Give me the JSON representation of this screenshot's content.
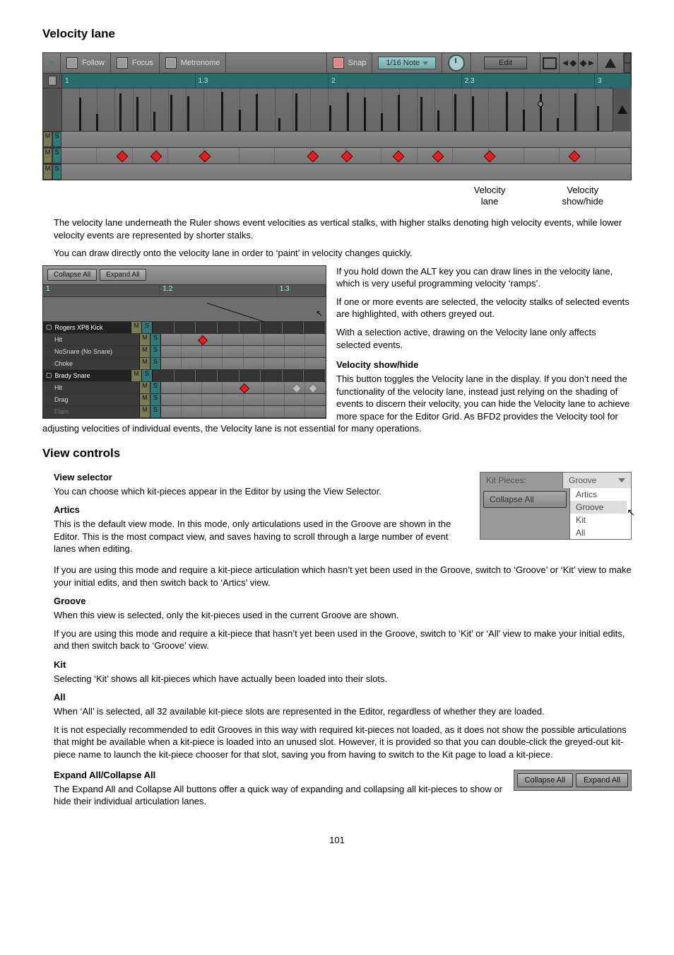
{
  "headings": {
    "velocity_lane": "Velocity lane",
    "velocity_show_hide": "Velocity show/hide",
    "view_controls": "View controls",
    "view_selector": "View selector",
    "artics": "Artics",
    "groove": "Groove",
    "kit": "Kit",
    "all": "All",
    "expand_collapse": "Expand All/Collapse All"
  },
  "toolbar": {
    "follow": "Follow",
    "focus": "Focus",
    "metronome": "Metronome",
    "snap": "Snap",
    "snap_value": "1/16 Note",
    "edit": "Edit"
  },
  "ruler": {
    "m1": "1",
    "m1_3": "1.3",
    "m2": "2",
    "m2_3": "2.3",
    "m3": "3"
  },
  "annot": {
    "velocity_lane_l1": "Velocity",
    "velocity_lane_l2": "lane",
    "show_hide_l1": "Velocity",
    "show_hide_l2": "show/hide"
  },
  "para": {
    "vl_1": "The velocity lane underneath the Ruler shows event velocities as vertical stalks, with higher stalks denoting high velocity events, while lower velocity events are represented by shorter stalks.",
    "vl_2": "You can draw directly onto the velocity lane in order to ‘paint’ in velocity changes quickly.",
    "vl_3": "If you hold down the ALT key you can draw lines in the velocity lane, which is very useful programming velocity ‘ramps’.",
    "vl_4": "If one or more events are selected, the velocity stalks of selected events are highlighted, with others greyed out.",
    "vl_5": "With a selection active, drawing on the Velocity lane only affects selected events.",
    "vsh_1": "This button toggles the Velocity lane in the display. If you don’t need the functionality of the velocity lane, instead just relying on the shading of events to discern their velocity, you can hide the Velocity lane to achieve more space for the Editor Grid. As BFD2 provides the Velocity tool for adjusting velocities of individual events, the Velocity lane is not essential for many operations.",
    "vs_1": "You can choose which kit-pieces appear in the Editor by using the View Selector.",
    "art_1": "This is the default view mode. In this mode, only articulations used in the Groove are shown in the Editor. This is the most compact view, and saves having to scroll through a large number of event lanes when editing.",
    "art_2": "If you are using this mode and require a kit-piece articulation which hasn’t yet been used in the Groove, switch to ‘Groove’ or ‘Kit’ view to make your initial edits, and then switch back to ‘Artics’ view.",
    "gr_1": "When this view is selected, only the kit-pieces used in the current Groove are shown.",
    "gr_2": "If you are using this mode and require a kit-piece that hasn’t yet been used in the Groove, switch to ‘Kit’ or ‘All’ view to make your initial edits, and then switch back to ‘Groove’ view.",
    "kit_1": "Selecting ‘Kit’ shows all kit-pieces which have actually been loaded into their slots.",
    "all_1": "When ‘All’ is selected, all 32 available kit-piece slots are represented in the Editor, regardless of whether they are loaded.",
    "all_2": "It is not especially recommended to edit Grooves in this way with required kit-pieces not loaded, as it does not show the possible articulations that might be available when a kit-piece is loaded into an unused slot. However, it is provided so that you can double-click the greyed-out kit-piece name to launch the kit-piece chooser for that slot, saving you from having to switch to the Kit page to load a kit-piece.",
    "ec_1": "The Expand All and Collapse All buttons offer a quick way of expanding and collapsing all kit-pieces to show or hide their individual articulation lanes."
  },
  "mini": {
    "collapse_all": "Collapse All",
    "expand_all": "Expand All",
    "ruler": {
      "m1": "1",
      "m1_2": "1.2",
      "m1_3": "1.3"
    },
    "tracks": {
      "kick_head": "Rogers XP8 Kick",
      "kick_hit": "Hit",
      "kick_nosnare": "NoSnare (No Snare)",
      "kick_choke": "Choke",
      "snare_head": "Brady Snare",
      "snare_hit": "Hit",
      "snare_drag": "Drag",
      "snare_flam": "Flam"
    }
  },
  "ms": {
    "m": "M",
    "s": "S"
  },
  "view_fig": {
    "kit_pieces": "Kit Pieces:",
    "current": "Groove",
    "collapse_all": "Collapse All",
    "options": {
      "artics": "Artics",
      "groove": "Groove",
      "kit": "Kit",
      "all": "All"
    }
  },
  "page": "101"
}
